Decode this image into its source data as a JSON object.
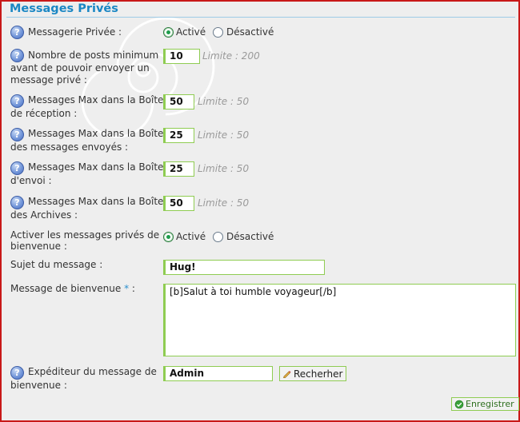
{
  "title": "Messages Privés",
  "help_glyph": "?",
  "rows": {
    "messagerie": {
      "label": "Messagerie Privée :",
      "opt_on": "Activé",
      "opt_off": "Désactivé",
      "selected": "Activé"
    },
    "min_posts": {
      "label_l1": "Nombre de posts minimum",
      "label_l2": "avant de pouvoir envoyer un",
      "label_l3": "message privé :",
      "value": "10",
      "limit": "Limite : 200"
    },
    "inbox": {
      "label_l1": "Messages Max dans la Boîte",
      "label_l2": "de réception :",
      "value": "50",
      "limit": "Limite : 50"
    },
    "sent": {
      "label_l1": "Messages Max dans la Boîte",
      "label_l2": "des messages envoyés :",
      "value": "25",
      "limit": "Limite : 50"
    },
    "outbox": {
      "label_l1": "Messages Max dans la Boîte",
      "label_l2": "d'envoi :",
      "value": "25",
      "limit": "Limite : 50"
    },
    "archives": {
      "label_l1": "Messages Max dans la Boîte",
      "label_l2": "des Archives :",
      "value": "50",
      "limit": "Limite : 50"
    },
    "welcome_enable": {
      "label_l1": "Activer les messages privés de",
      "label_l2": "bienvenue :",
      "opt_on": "Activé",
      "opt_off": "Désactivé",
      "selected": "Activé"
    },
    "subject": {
      "label": "Sujet du message :",
      "value": "Hug!"
    },
    "welcome_msg": {
      "label": "Message de bienvenue",
      "required_mark": "*",
      "label_suffix": ":",
      "value": "[b]Salut à toi humble voyageur[/b]"
    },
    "sender": {
      "label_l1": "Expéditeur du message de",
      "label_l2": "bienvenue :",
      "value": "Admin",
      "search_label": "Recherher"
    }
  },
  "save_label": "Enregistrer",
  "colors": {
    "accent": "#1a87c4",
    "field_border": "#8fcc52",
    "radio_on": "#1e9d4c",
    "frame": "#c81818"
  }
}
